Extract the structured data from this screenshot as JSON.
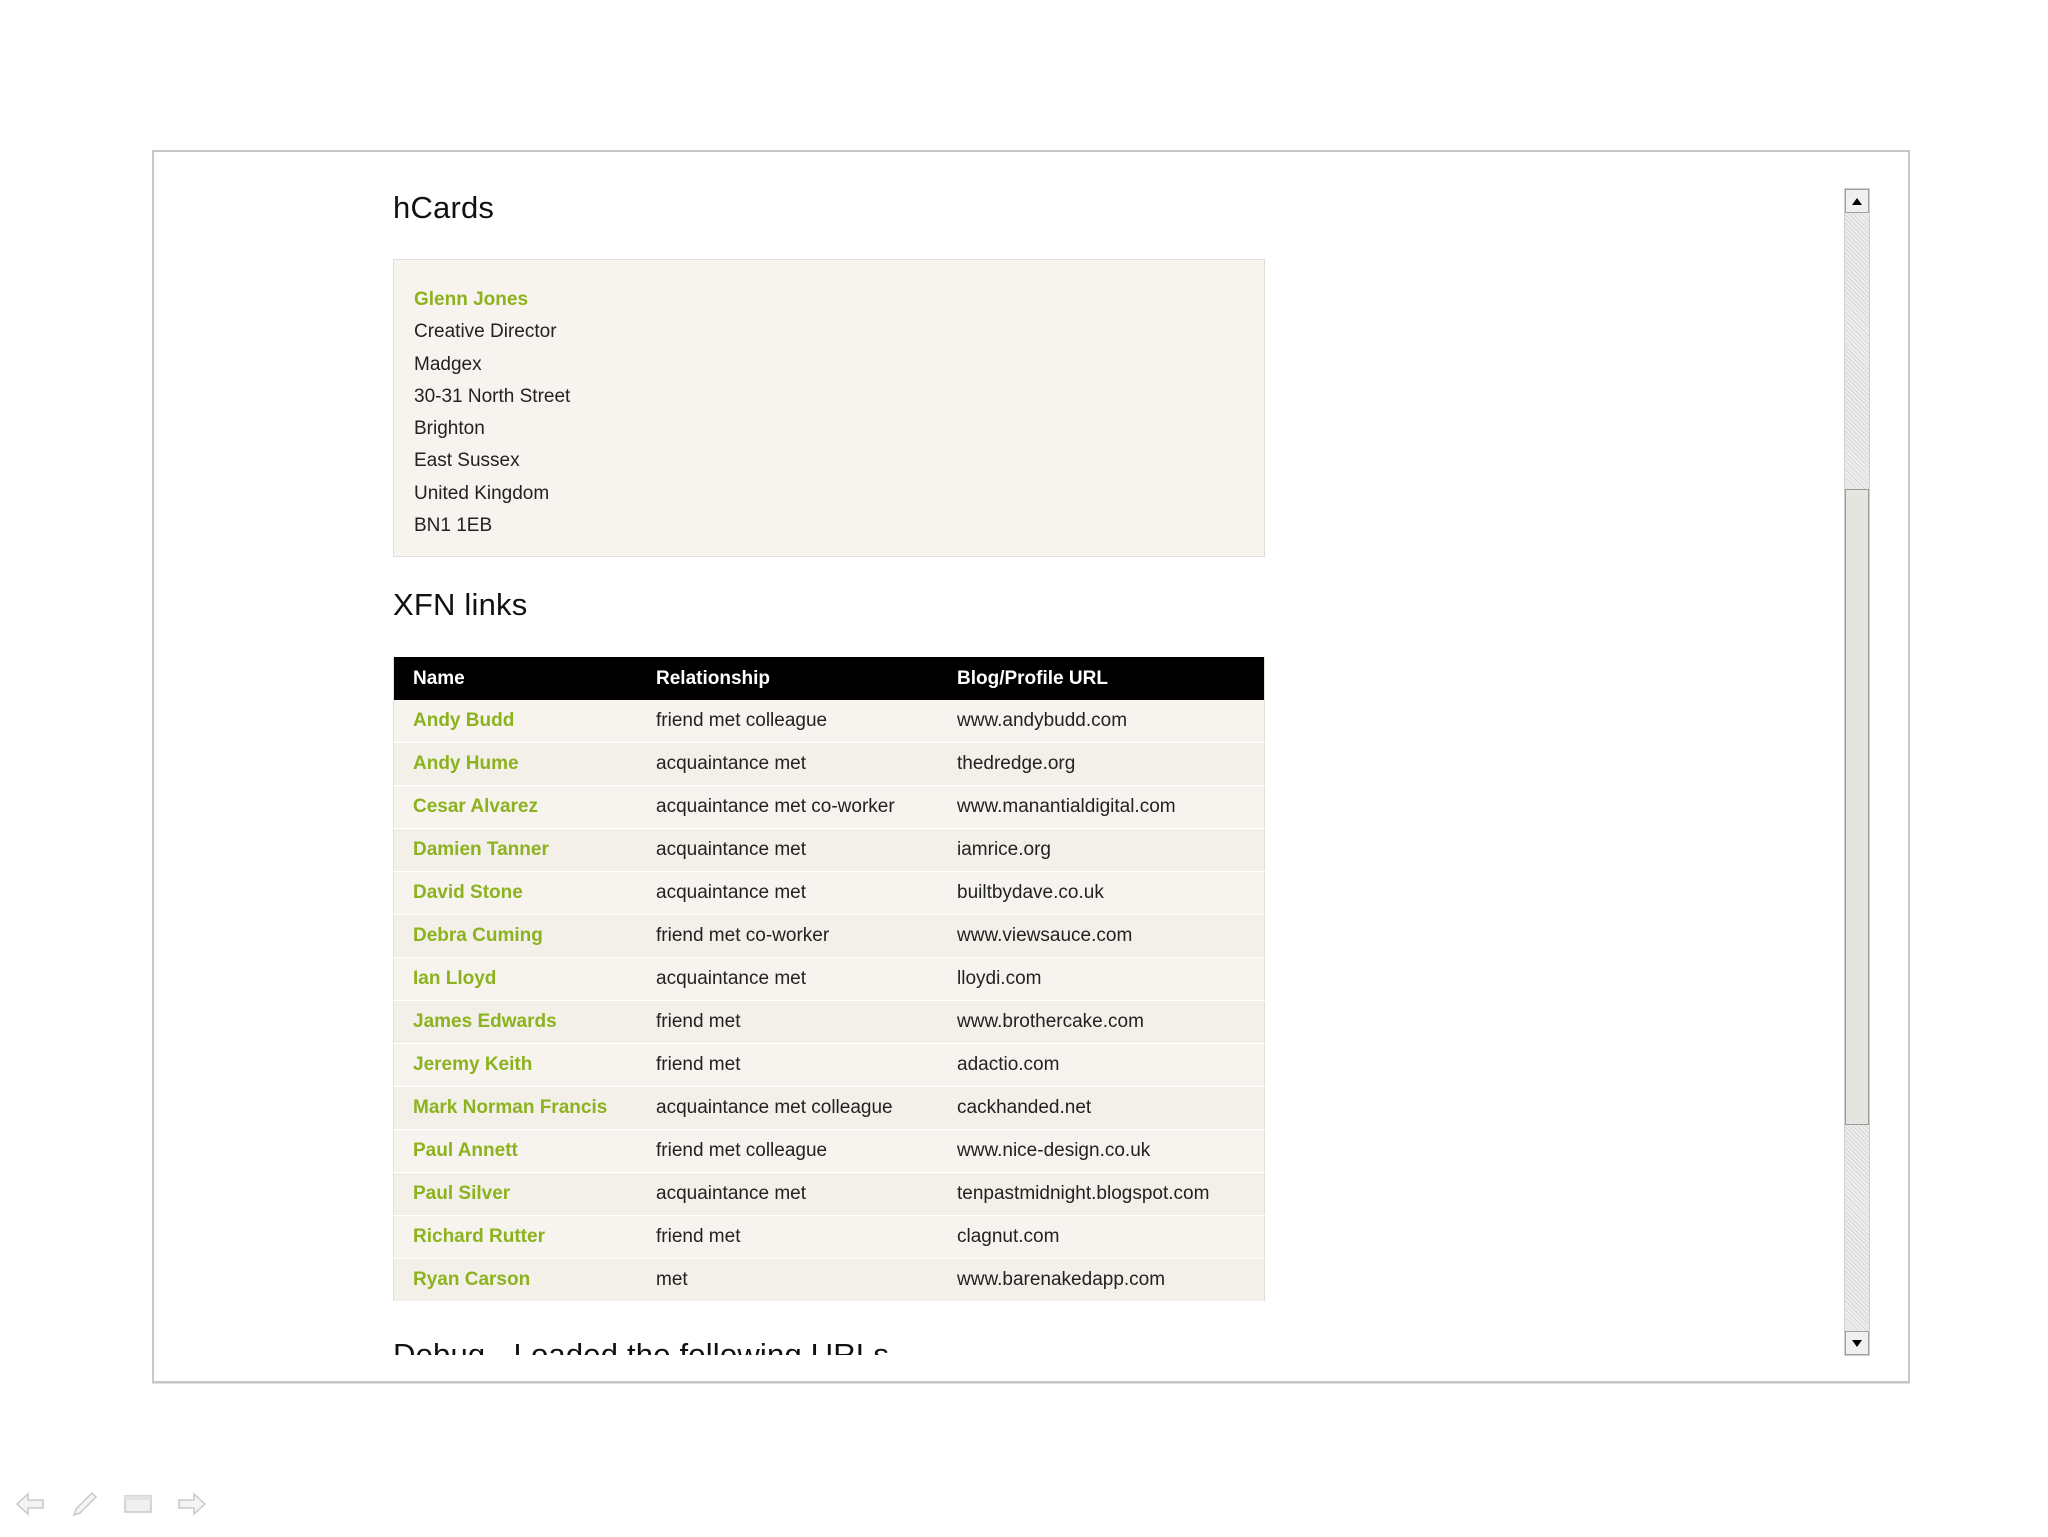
{
  "headings": {
    "hcards": "hCards",
    "xfn": "XFN links",
    "debug": "Debug - Loaded the following URLs"
  },
  "hcard": {
    "fn": "Glenn Jones",
    "title": "Creative Director",
    "org": "Madgex",
    "street": "30-31 North Street",
    "locality": "Brighton",
    "region": "East Sussex",
    "country": "United Kingdom",
    "postcode": "BN1 1EB"
  },
  "xfn_table": {
    "headers": [
      "Name",
      "Relationship",
      "Blog/Profile URL"
    ],
    "rows": [
      {
        "name": "Andy Budd",
        "rel": "friend met colleague",
        "url": "www.andybudd.com"
      },
      {
        "name": "Andy Hume",
        "rel": "acquaintance met",
        "url": "thedredge.org"
      },
      {
        "name": "Cesar Alvarez",
        "rel": "acquaintance met co-worker",
        "url": "www.manantialdigital.com"
      },
      {
        "name": "Damien Tanner",
        "rel": "acquaintance met",
        "url": "iamrice.org"
      },
      {
        "name": "David Stone",
        "rel": "acquaintance met",
        "url": "builtbydave.co.uk"
      },
      {
        "name": "Debra Cuming",
        "rel": "friend met co-worker",
        "url": "www.viewsauce.com"
      },
      {
        "name": "Ian Lloyd",
        "rel": "acquaintance met",
        "url": "lloydi.com"
      },
      {
        "name": "James Edwards",
        "rel": "friend met",
        "url": "www.brothercake.com"
      },
      {
        "name": "Jeremy Keith",
        "rel": "friend met",
        "url": "adactio.com"
      },
      {
        "name": "Mark Norman Francis",
        "rel": "acquaintance met colleague",
        "url": "cackhanded.net"
      },
      {
        "name": "Paul Annett",
        "rel": "friend met colleague",
        "url": "www.nice-design.co.uk"
      },
      {
        "name": "Paul Silver",
        "rel": "acquaintance met",
        "url": "tenpastmidnight.blogspot.com"
      },
      {
        "name": "Richard Rutter",
        "rel": "friend met",
        "url": "clagnut.com"
      },
      {
        "name": "Ryan Carson",
        "rel": "met",
        "url": "www.barenakedapp.com"
      }
    ]
  },
  "colors": {
    "link": "#8cb21e",
    "box_bg": "#f7f4ef",
    "header_bg": "#000000"
  },
  "icons": [
    "back-arrow-icon",
    "pen-icon",
    "screen-icon",
    "forward-arrow-icon"
  ]
}
